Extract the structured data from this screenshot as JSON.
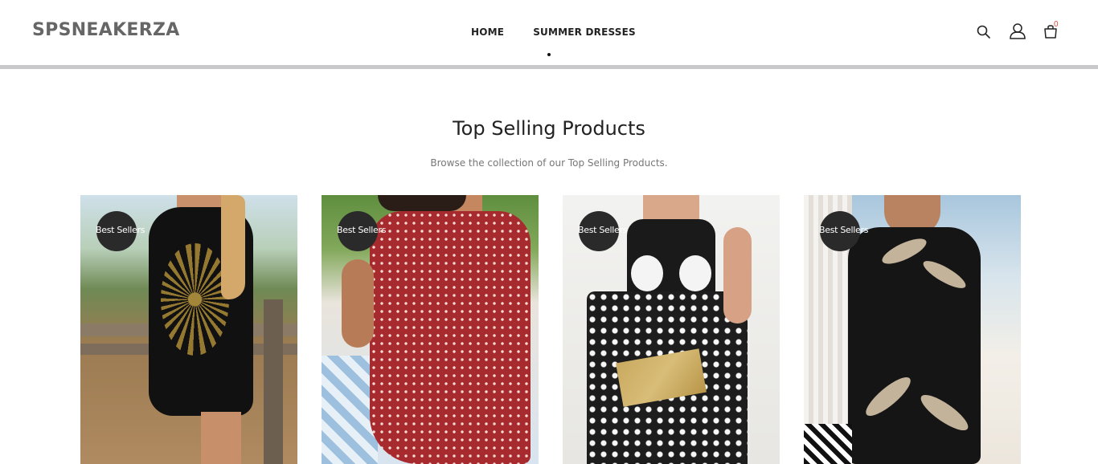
{
  "header": {
    "logo": "SPSNEAKERZA",
    "nav": [
      {
        "label": "HOME"
      },
      {
        "label": "SUMMER DRESSES"
      }
    ],
    "cart_count": "0",
    "icons": [
      "search-icon",
      "user-icon",
      "cart-icon"
    ]
  },
  "section": {
    "title": "Top Selling Products",
    "subtitle": "Browse the collection of our Top Selling Products."
  },
  "products": [
    {
      "badge": "Best Sellers"
    },
    {
      "badge": "Best Sellers"
    },
    {
      "badge": "Best Sellers"
    },
    {
      "badge": "Best Sellers"
    }
  ],
  "colors": {
    "logo": "#666666",
    "badge": "#2a2a2a",
    "cart_count": "#e74c3c",
    "header_rule": "#c9c9cc"
  }
}
